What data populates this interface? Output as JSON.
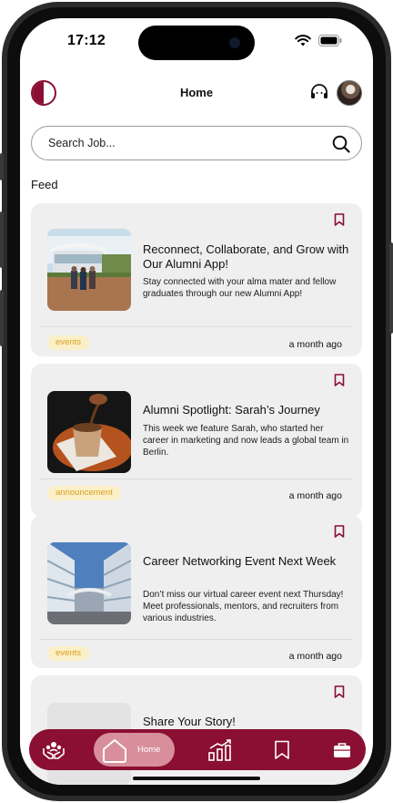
{
  "status_bar": {
    "time": "17:12"
  },
  "header": {
    "title": "Home"
  },
  "search": {
    "placeholder": "Search Job..."
  },
  "feed": {
    "label": "Feed",
    "posts": [
      {
        "title": "Reconnect, Collaborate, and Grow with Our Alumni App!",
        "body": "Stay connected with your alma mater and fellow graduates through our new Alumni App!",
        "tag": "events",
        "time": "a month ago"
      },
      {
        "title": "Alumni Spotlight: Sarah’s Journey",
        "body": "This week we feature Sarah, who started her career in marketing and now leads a global team in Berlin.",
        "tag": "announcement",
        "time": "a month ago"
      },
      {
        "title": "Career Networking Event Next Week",
        "body": "Don’t miss our virtual career event next Thursday! Meet professionals, mentors, and recruiters from various industries.",
        "tag": "events",
        "time": "a month ago"
      },
      {
        "title": "Share Your Story!"
      }
    ]
  },
  "bottom_nav": {
    "items": [
      {
        "icon": "community-icon"
      },
      {
        "icon": "home-icon",
        "label": "Home",
        "active": true
      },
      {
        "icon": "stats-icon"
      },
      {
        "icon": "bookmark-icon"
      },
      {
        "icon": "briefcase-icon"
      }
    ]
  },
  "colors": {
    "brand": "#8a0f32",
    "tag_bg": "#fbefc8",
    "tag_text": "#d8a020",
    "card_bg": "#efefef"
  }
}
